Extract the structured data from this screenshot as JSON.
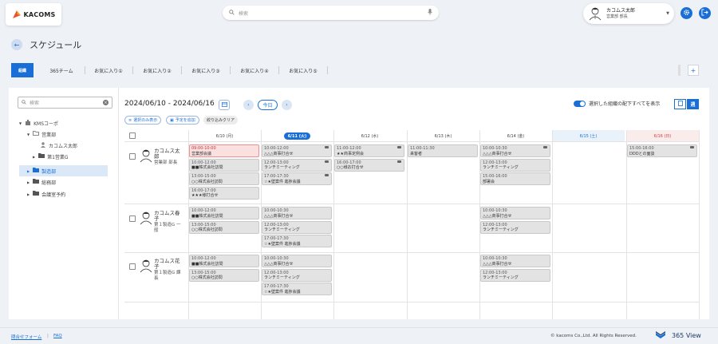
{
  "header": {
    "logo_text": "KACOMS",
    "search_placeholder": "検索",
    "user_name": "カコムス太郎",
    "user_dept": "営業部 部長"
  },
  "page": {
    "title": "スケジュール"
  },
  "tabs": [
    {
      "label": "組織",
      "active": true
    },
    {
      "label": "365チーム"
    },
    {
      "label": "お気に入り①"
    },
    {
      "label": "お気に入り②"
    },
    {
      "label": "お気に入り③"
    },
    {
      "label": "お気に入り④"
    },
    {
      "label": "お気に入り⑤"
    }
  ],
  "sidebar": {
    "search_placeholder": "検索",
    "tree": [
      {
        "label": "KMSコーポ"
      },
      {
        "label": "営業部"
      },
      {
        "label": "カコムス太郎"
      },
      {
        "label": "第1営業G"
      },
      {
        "label": "製造部",
        "selected": true
      },
      {
        "label": "総務部"
      },
      {
        "label": "会議室予約"
      }
    ]
  },
  "toolbar": {
    "date_range": "2024/06/10 - 2024/06/16",
    "today": "今日",
    "chip_show_selected": "選択のみ表示",
    "chip_add_schedule": "予定を追加",
    "chip_clear": "絞り込みクリア",
    "toggle_label": "選択した組織の配下すべてを表示",
    "view_day": "日",
    "view_week": "週"
  },
  "days": [
    {
      "label": "6/10 (月)"
    },
    {
      "label": "6/11 (火)",
      "today": true
    },
    {
      "label": "6/12 (水)"
    },
    {
      "label": "6/13 (木)"
    },
    {
      "label": "6/14 (金)"
    },
    {
      "label": "6/15 (土)",
      "kind": "sat"
    },
    {
      "label": "6/16 (日)",
      "kind": "sun"
    }
  ],
  "people": [
    {
      "name": "カコムス太郎",
      "dept": "営業部 部長",
      "events": [
        {
          "day": 0,
          "slot": 0,
          "time": "09:00-10:00",
          "title": "営業部会議",
          "style": "red"
        },
        {
          "day": 0,
          "slot": 1,
          "time": "10:00-12:00",
          "title": "■■株式会社訪問"
        },
        {
          "day": 0,
          "slot": 2,
          "time": "13:00-15:00",
          "title": "○○株式会社訪問"
        },
        {
          "day": 0,
          "slot": 3,
          "time": "16:00-17:00",
          "title": "★★★様打合せ"
        },
        {
          "day": 1,
          "slot": 0,
          "time": "10:00-12:00",
          "title": "△△△商事打合せ",
          "icon": true
        },
        {
          "day": 1,
          "slot": 1,
          "time": "12:00-13:00",
          "title": "ランチミーティング",
          "icon": true
        },
        {
          "day": 1,
          "slot": 2,
          "time": "17:00-17:30",
          "title": "☆★壁案件 進捗会議",
          "icon": true
        },
        {
          "day": 2,
          "slot": 0,
          "time": "11:00-12:00",
          "title": "★★商事定例会",
          "icon": true
        },
        {
          "day": 2,
          "slot": 1,
          "time": "16:00-17:00",
          "title": "○○様お打合せ",
          "icon": true
        },
        {
          "day": 3,
          "slot": 0,
          "time": "11:00-11:30",
          "title": "来客者"
        },
        {
          "day": 4,
          "slot": 0,
          "time": "10:00-10:30",
          "title": "△△△商事打合せ",
          "icon": true
        },
        {
          "day": 4,
          "slot": 1,
          "time": "12:00-13:00",
          "title": "ランチミーティング"
        },
        {
          "day": 4,
          "slot": 2,
          "time": "15:00-16:00",
          "title": "部署会"
        },
        {
          "day": 6,
          "slot": 0,
          "time": "15:00-16:00",
          "title": "DDDとの面談",
          "icon": true
        }
      ]
    },
    {
      "name": "カコムス春子",
      "dept": "第１製造G 一般",
      "events": [
        {
          "day": 0,
          "slot": 0,
          "time": "10:00-12:00",
          "title": "■■株式会社訪問"
        },
        {
          "day": 0,
          "slot": 1,
          "time": "13:00-15:00",
          "title": "○○株式会社訪問"
        },
        {
          "day": 1,
          "slot": 0,
          "time": "10:00-10:30",
          "title": "△△△商事打合せ"
        },
        {
          "day": 1,
          "slot": 1,
          "time": "12:00-13:00",
          "title": "ランチミーティング"
        },
        {
          "day": 1,
          "slot": 2,
          "time": "17:00-17:30",
          "title": "☆★壁案件 進捗会議"
        },
        {
          "day": 4,
          "slot": 0,
          "time": "10:00-10:30",
          "title": "△△△商事打合せ"
        },
        {
          "day": 4,
          "slot": 1,
          "time": "12:00-13:00",
          "title": "ランチミーティング"
        }
      ]
    },
    {
      "name": "カコムス花子",
      "dept": "第１製造G 課長",
      "events": [
        {
          "day": 0,
          "slot": 0,
          "time": "10:00-12:00",
          "title": "■■株式会社訪問"
        },
        {
          "day": 0,
          "slot": 1,
          "time": "13:00-15:00",
          "title": "○○株式会社訪問"
        },
        {
          "day": 1,
          "slot": 0,
          "time": "10:00-10:30",
          "title": "△△△商事打合せ"
        },
        {
          "day": 1,
          "slot": 1,
          "time": "12:00-13:00",
          "title": "ランチミーティング"
        },
        {
          "day": 1,
          "slot": 2,
          "time": "17:00-17:30",
          "title": "☆★壁案件 進捗会議"
        },
        {
          "day": 4,
          "slot": 0,
          "time": "10:00-10:30",
          "title": "△△△商事打合せ"
        },
        {
          "day": 4,
          "slot": 1,
          "time": "12:00-13:00",
          "title": "ランチミーティング"
        }
      ]
    }
  ],
  "footer": {
    "link1": "問合せフォーム",
    "link2": "FAQ",
    "copyright": "© kacoms Co.,Ltd. All Rights Reserved.",
    "brand": "365 View"
  },
  "colors": {
    "accent": "#1a6fd6",
    "event_bg": "#e3e3e3",
    "event_red_bg": "#fbe0e0",
    "sun": "#d33c3c",
    "sat": "#1a6fd6"
  }
}
